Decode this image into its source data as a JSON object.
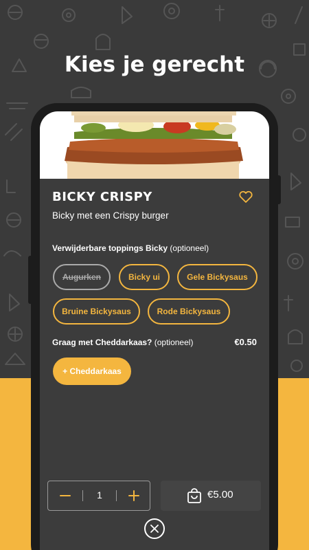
{
  "headline": "Kies je gerecht",
  "product": {
    "name": "BICKY CRISPY",
    "description": "Bicky met een Crispy burger",
    "favorite_icon": "heart-outline-icon"
  },
  "toppings": {
    "title": "Verwijderbare toppings Bicky",
    "optional": "(optioneel)",
    "items": [
      {
        "label": "Augurken",
        "removed": true
      },
      {
        "label": "Bicky ui",
        "removed": false
      },
      {
        "label": "Gele Bickysaus",
        "removed": false
      },
      {
        "label": "Bruine Bickysaus",
        "removed": false
      },
      {
        "label": "Rode Bickysaus",
        "removed": false
      }
    ]
  },
  "extra": {
    "title": "Graag met Cheddarkaas?",
    "optional": "(optioneel)",
    "price": "€0.50",
    "button_label": "+ Cheddarkaas"
  },
  "order": {
    "quantity": "1",
    "total": "€5.00",
    "minus_icon": "minus-icon",
    "plus_icon": "plus-icon",
    "cart_icon": "shopping-bag-icon",
    "close_icon": "close-icon"
  },
  "colors": {
    "accent": "#f4b63f",
    "background": "#3a3a3a",
    "surface": "#3c3c3c",
    "removed_chip": "#aaaaaa"
  }
}
